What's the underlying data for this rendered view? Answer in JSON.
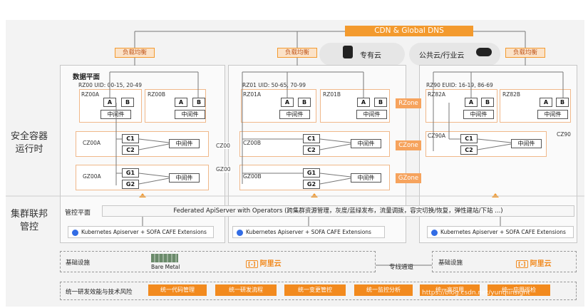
{
  "top": {
    "cdn": "CDN & Global DNS",
    "lb": "负载均衡",
    "private_cloud": "专有云",
    "public_cloud": "公共云/行业云"
  },
  "left_labels": {
    "runtime": "安全容器\n运行时",
    "fed": "集群联邦\n管控"
  },
  "data_plane": "数据平面",
  "control_plane": "管控平面",
  "region_left": {
    "uid": "RZ00 UID: 00-15, 20-49",
    "rz_a": "RZ00A",
    "rz_b": "RZ00B",
    "cz": "CZ00A",
    "gz": "GZ00A",
    "cz_side": "CZ00",
    "gz_side": "GZ00"
  },
  "region_mid": {
    "uid": "RZ01 UID: 50-65, 70-99",
    "rz_a": "RZ01A",
    "rz_b": "RZ01B",
    "cz": "CZ00B",
    "gz": "GZ00B"
  },
  "region_right": {
    "uid": "RZ90 EUID: 16-19, 86-69",
    "rz_a": "RZ82A",
    "rz_b": "RZ82B",
    "cz": "CZ90A",
    "cz_side": "CZ90"
  },
  "boxes": {
    "a": "A",
    "b": "B",
    "mw": "中间件",
    "c1": "C1",
    "c2": "C2",
    "g1": "G1",
    "g2": "G2"
  },
  "zones": {
    "rzone": "RZone",
    "czone": "CZone",
    "gzone": "GZone"
  },
  "fed_apiserver": "Federated ApiServer with Operators (跨集群资源管理，灰度/蓝绿发布，流量调拨，容灾切换/恢复，弹性建站/下站 ...)",
  "k8s": "Kubernetes Apiserver + SOFA CAFE Extensions",
  "infra": {
    "label": "基础设施",
    "bare_metal": "Bare Metal",
    "aliyun": "阿里云",
    "dedicated": "专线通道"
  },
  "unified": {
    "label": "统一研发效能与技术风险",
    "buttons": [
      "统一代码管理",
      "统一研发流程",
      "统一变更管控",
      "统一监控分析",
      "统一高可用",
      "统一应用巡检"
    ]
  },
  "watermark": "https://blog.csdn.net/yunqiinsight",
  "colors": {
    "orange": "#f39a2e",
    "light_orange": "#fbe2c8"
  }
}
